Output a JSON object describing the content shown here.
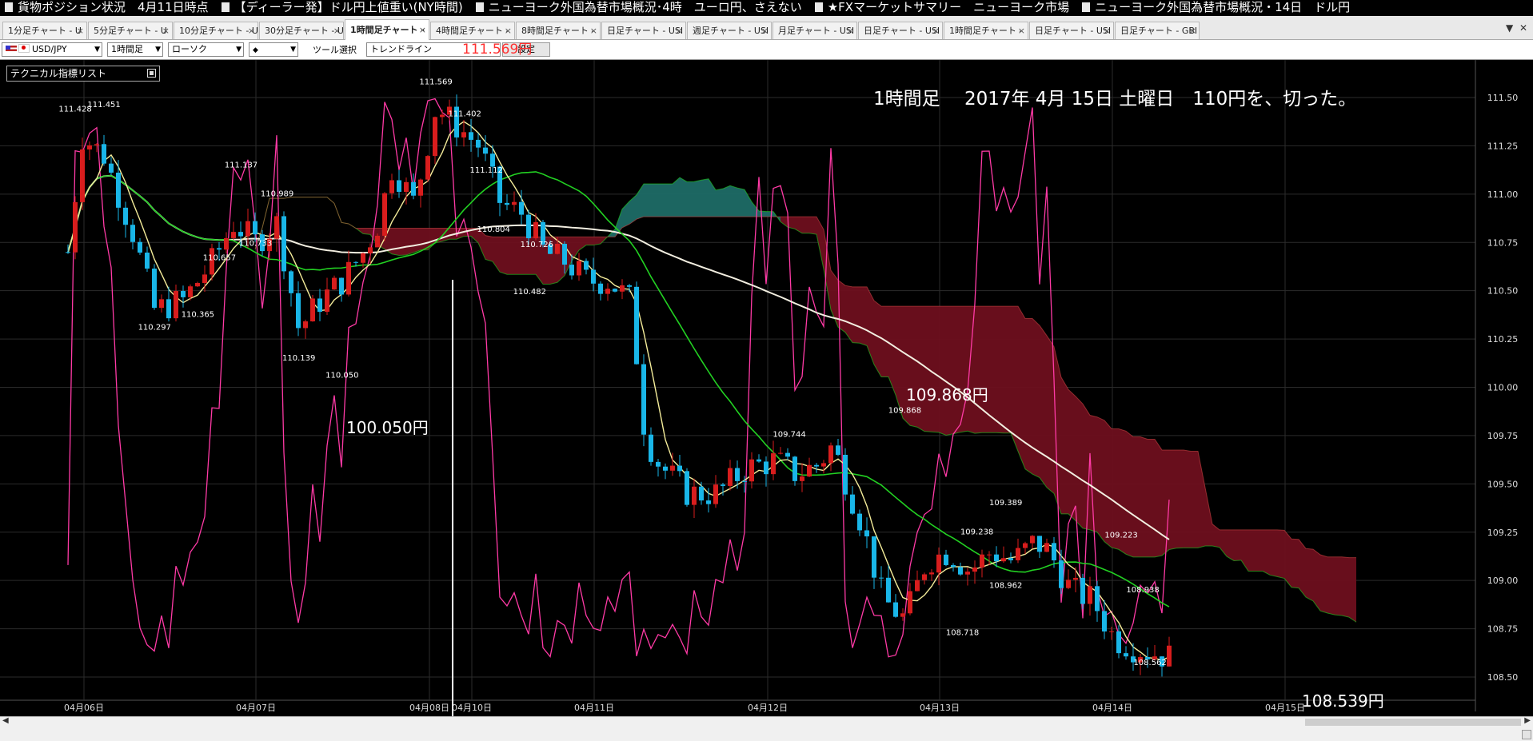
{
  "news_ticker": [
    "貨物ポジション状況　4月11日時点",
    "【ディーラー発】ドル円上値重い(NY時間)",
    "ニューヨーク外国為替市場概況･4時　ユーロ円、さえない",
    "★FXマーケットサマリー　ニューヨーク市場",
    "ニューヨーク外国為替市場概況・14日　ドル円"
  ],
  "tabs": [
    {
      "label": "1分足チャート - U",
      "active": false
    },
    {
      "label": "5分足チャート - U",
      "active": false
    },
    {
      "label": "10分足チャート - U",
      "active": false
    },
    {
      "label": "30分足チャート - U",
      "active": false
    },
    {
      "label": "1時間足チャート -",
      "active": true
    },
    {
      "label": "4時間足チャート -",
      "active": false
    },
    {
      "label": "8時間足チャート -",
      "active": false
    },
    {
      "label": "日足チャート - USI",
      "active": false
    },
    {
      "label": "週足チャート - USI",
      "active": false
    },
    {
      "label": "月足チャート - USI",
      "active": false
    },
    {
      "label": "日足チャート - USI",
      "active": false
    },
    {
      "label": "1時間足チャート -",
      "active": false
    },
    {
      "label": "日足チャート - USI",
      "active": false
    },
    {
      "label": "日足チャート - GBI",
      "active": false
    }
  ],
  "toolbar": {
    "currency_pair": "USD/JPY",
    "timeframe": "1時間足",
    "chart_type": "ローソク",
    "tool_label": "ツール選択",
    "tool_value": "トレンドライン",
    "settings_button": "設定",
    "current_price": "111.569円"
  },
  "indicator_panel": {
    "label": "テクニカル指標リスト"
  },
  "annotations": {
    "title": "1時間足　 2017年 4月 15日 土曜日　110円を、切った。",
    "low_label": "100.050円",
    "mid_label": "109.868円",
    "close_label": "108.539円"
  },
  "chart_data": {
    "type": "candlestick",
    "title": "1時間足　 2017年 4月 15日 土曜日　110円を、切った。",
    "symbol": "USD/JPY",
    "timeframe": "1時間足",
    "ylim": [
      108.45,
      111.6
    ],
    "yticks": [
      "111.50",
      "111.25",
      "111.00",
      "110.75",
      "110.50",
      "110.25",
      "110.00",
      "109.75",
      "109.50",
      "109.25",
      "109.00",
      "108.75",
      "108.50"
    ],
    "x_ticks": [
      "04月06日",
      "04月07日",
      "04月08日",
      "04月10日",
      "04月11日",
      "04月12日",
      "04月13日",
      "04月14日",
      "04月15日"
    ],
    "grid": true,
    "colors": {
      "up_candle": "#d81d1d",
      "down_candle": "#19b6e8",
      "cloud_bull": "#0a8a0a",
      "cloud_bear": "#6e0f1d",
      "cloud_teal": "#1e6b66",
      "cloud_navy": "#2a3a7a",
      "ma_short": "#f4ec9a",
      "ma_mid": "#22d022",
      "ma_long": "#f2eee0",
      "oscillator": "#ff3aa6"
    },
    "price_labels": [
      {
        "x": "04-06 01",
        "value": 111.428
      },
      {
        "x": "04-06 05",
        "value": 111.451
      },
      {
        "x": "04-06 12",
        "value": 110.297
      },
      {
        "x": "04-06 18",
        "value": 110.365
      },
      {
        "x": "04-06 21",
        "value": 110.657
      },
      {
        "x": "04-07 00",
        "value": 111.137
      },
      {
        "x": "04-07 02",
        "value": 110.733
      },
      {
        "x": "04-07 05",
        "value": 110.989
      },
      {
        "x": "04-07 08",
        "value": 110.139
      },
      {
        "x": "04-07 14",
        "value": 110.05
      },
      {
        "x": "04-10 03",
        "value": 111.569
      },
      {
        "x": "04-10 07",
        "value": 111.402
      },
      {
        "x": "04-10 10",
        "value": 111.112
      },
      {
        "x": "04-10 11",
        "value": 110.804
      },
      {
        "x": "04-10 17",
        "value": 110.726
      },
      {
        "x": "04-10 16",
        "value": 110.482
      },
      {
        "x": "04-12 04",
        "value": 109.744
      },
      {
        "x": "04-12 20",
        "value": 109.868
      },
      {
        "x": "04-13 04",
        "value": 108.718
      },
      {
        "x": "04-13 06",
        "value": 109.238
      },
      {
        "x": "04-13 10",
        "value": 109.389
      },
      {
        "x": "04-13 10",
        "value": 108.962
      },
      {
        "x": "04-14 02",
        "value": 109.223
      },
      {
        "x": "04-14 05",
        "value": 108.938
      },
      {
        "x": "04-14 06",
        "value": 108.562
      }
    ],
    "close_anchors": [
      [
        "04-06 00",
        110.7
      ],
      [
        "04-06 02",
        111.3
      ],
      [
        "04-06 05",
        111.2
      ],
      [
        "04-06 09",
        110.8
      ],
      [
        "04-06 12",
        110.4
      ],
      [
        "04-06 16",
        110.45
      ],
      [
        "04-06 20",
        110.65
      ],
      [
        "04-06 23",
        110.85
      ],
      [
        "04-07 02",
        110.75
      ],
      [
        "04-07 05",
        110.85
      ],
      [
        "04-07 08",
        110.3
      ],
      [
        "04-07 11",
        110.45
      ],
      [
        "04-07 14",
        110.55
      ],
      [
        "04-07 17",
        110.7
      ],
      [
        "04-07 19",
        110.85
      ],
      [
        "04-07 21",
        111.15
      ],
      [
        "04-10 00",
        110.95
      ],
      [
        "04-10 03",
        111.45
      ],
      [
        "04-10 06",
        111.35
      ],
      [
        "04-10 09",
        111.25
      ],
      [
        "04-10 12",
        110.95
      ],
      [
        "04-10 15",
        110.9
      ],
      [
        "04-10 18",
        110.7
      ],
      [
        "04-10 21",
        110.65
      ],
      [
        "04-11 00",
        110.55
      ],
      [
        "04-11 03",
        110.55
      ],
      [
        "04-11 06",
        110.45
      ],
      [
        "04-11 08",
        109.75
      ],
      [
        "04-11 10",
        109.6
      ],
      [
        "04-11 14",
        109.45
      ],
      [
        "04-11 18",
        109.45
      ],
      [
        "04-11 22",
        109.58
      ],
      [
        "04-12 02",
        109.62
      ],
      [
        "04-12 05",
        109.55
      ],
      [
        "04-12 08",
        109.6
      ],
      [
        "04-12 10",
        109.7
      ],
      [
        "04-12 14",
        109.3
      ],
      [
        "04-12 17",
        108.9
      ],
      [
        "04-12 20",
        108.8
      ],
      [
        "04-12 23",
        109.1
      ],
      [
        "04-13 02",
        109.15
      ],
      [
        "04-13 05",
        109.05
      ],
      [
        "04-13 08",
        109.15
      ],
      [
        "04-13 11",
        109.1
      ],
      [
        "04-13 14",
        109.2
      ],
      [
        "04-13 16",
        109.15
      ],
      [
        "04-13 19",
        108.95
      ],
      [
        "04-13 22",
        108.9
      ],
      [
        "04-14 01",
        108.7
      ],
      [
        "04-14 04",
        108.65
      ],
      [
        "04-14 07",
        108.62
      ],
      [
        "04-14 09",
        108.6
      ]
    ]
  }
}
